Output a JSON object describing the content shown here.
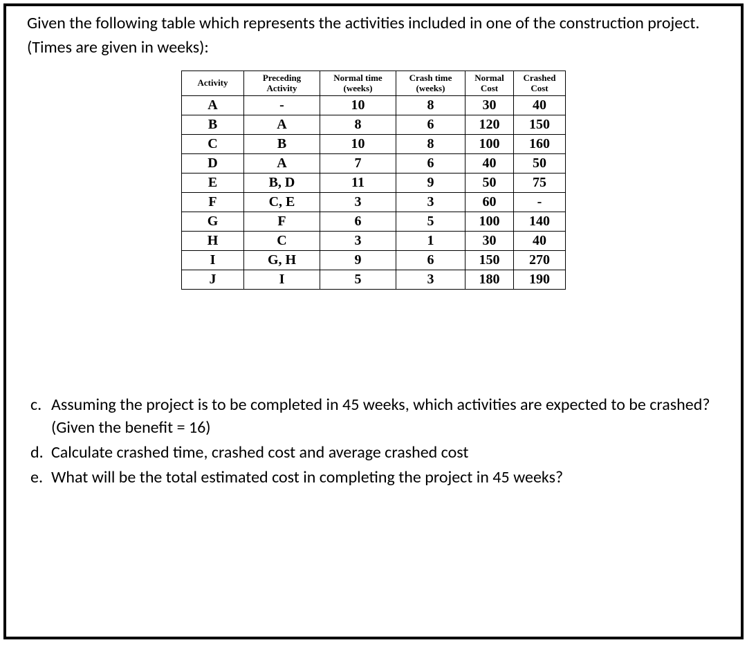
{
  "intro": "Given the following table which represents the activities included in one of the construction project. (Times are given in weeks):",
  "table": {
    "headers": {
      "activity": "Activity",
      "preceding": "Preceding Activity",
      "normal_time": "Normal time (weeks)",
      "crash_time": "Crash time (weeks)",
      "normal_cost": "Normal Cost",
      "crashed_cost": "Crashed Cost"
    },
    "rows": [
      {
        "activity": "A",
        "preceding": "-",
        "normal_time": "10",
        "crash_time": "8",
        "normal_cost": "30",
        "crashed_cost": "40"
      },
      {
        "activity": "B",
        "preceding": "A",
        "normal_time": "8",
        "crash_time": "6",
        "normal_cost": "120",
        "crashed_cost": "150"
      },
      {
        "activity": "C",
        "preceding": "B",
        "normal_time": "10",
        "crash_time": "8",
        "normal_cost": "100",
        "crashed_cost": "160"
      },
      {
        "activity": "D",
        "preceding": "A",
        "normal_time": "7",
        "crash_time": "6",
        "normal_cost": "40",
        "crashed_cost": "50"
      },
      {
        "activity": "E",
        "preceding": "B, D",
        "normal_time": "11",
        "crash_time": "9",
        "normal_cost": "50",
        "crashed_cost": "75"
      },
      {
        "activity": "F",
        "preceding": "C, E",
        "normal_time": "3",
        "crash_time": "3",
        "normal_cost": "60",
        "crashed_cost": "-"
      },
      {
        "activity": "G",
        "preceding": "F",
        "normal_time": "6",
        "crash_time": "5",
        "normal_cost": "100",
        "crashed_cost": "140"
      },
      {
        "activity": "H",
        "preceding": "C",
        "normal_time": "3",
        "crash_time": "1",
        "normal_cost": "30",
        "crashed_cost": "40"
      },
      {
        "activity": "I",
        "preceding": "G, H",
        "normal_time": "9",
        "crash_time": "6",
        "normal_cost": "150",
        "crashed_cost": "270"
      },
      {
        "activity": "J",
        "preceding": "I",
        "normal_time": "5",
        "crash_time": "3",
        "normal_cost": "180",
        "crashed_cost": "190"
      }
    ]
  },
  "questions": [
    {
      "label": "c.",
      "text": "Assuming the project is to be completed in 45 weeks, which activities are expected to be crashed? (Given the benefit = 16)"
    },
    {
      "label": "d.",
      "text": "Calculate crashed time, crashed cost and average crashed cost"
    },
    {
      "label": "e.",
      "text": "What will be the total estimated cost in completing the project in 45 weeks?"
    }
  ]
}
